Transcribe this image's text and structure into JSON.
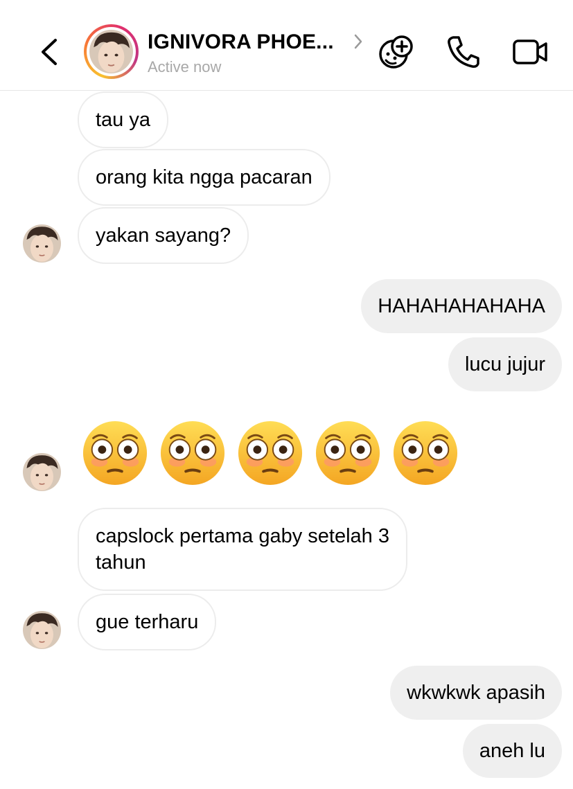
{
  "header": {
    "contact_name": "IGNIVORA PHOE...",
    "status": "Active now"
  },
  "messages": [
    {
      "side": "in",
      "text": "tau ya"
    },
    {
      "side": "in",
      "text": "orang kita ngga pacaran"
    },
    {
      "side": "in",
      "text": "yakan sayang?"
    },
    {
      "side": "out",
      "text": "HAHAHAHAHAHA"
    },
    {
      "side": "out",
      "text": "lucu jujur"
    },
    {
      "side": "in",
      "emoji": "flushed-face",
      "count": 5
    },
    {
      "side": "in",
      "line1": "capslock pertama gaby setelah 3",
      "line2": "tahun"
    },
    {
      "side": "in",
      "text": "gue terharu"
    },
    {
      "side": "out",
      "text": "wkwkwk apasih"
    },
    {
      "side": "out",
      "text": "aneh lu"
    }
  ],
  "colors": {
    "incoming_bubble_bg": "#ffffff",
    "incoming_bubble_border": "#ececec",
    "outgoing_bubble_bg": "#efefef",
    "status_text": "#a8a8a8",
    "story_ring": [
      "#f9c22e",
      "#f77737",
      "#e1306c",
      "#c13584"
    ]
  },
  "icons": [
    "back-arrow-icon",
    "chevron-right-icon",
    "effects-icon",
    "phone-icon",
    "video-camera-icon",
    "flushed-face-emoji"
  ]
}
